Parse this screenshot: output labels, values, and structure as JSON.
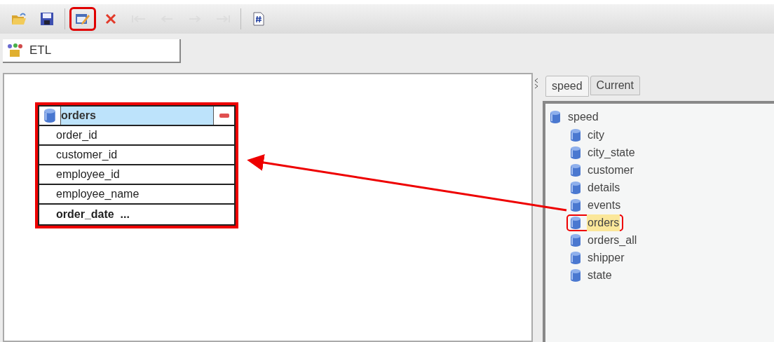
{
  "toolbar": [
    {
      "kind": "open",
      "disabled": false,
      "highlighted": false
    },
    {
      "kind": "save",
      "disabled": false,
      "highlighted": false
    },
    {
      "kind": "separator"
    },
    {
      "kind": "edit",
      "disabled": false,
      "highlighted": true
    },
    {
      "kind": "delete",
      "disabled": false,
      "highlighted": false
    },
    {
      "kind": "first",
      "disabled": true,
      "highlighted": false
    },
    {
      "kind": "prev",
      "disabled": true,
      "highlighted": false
    },
    {
      "kind": "next",
      "disabled": true,
      "highlighted": false
    },
    {
      "kind": "last",
      "disabled": true,
      "highlighted": false
    },
    {
      "kind": "separator"
    },
    {
      "kind": "script",
      "disabled": false,
      "highlighted": false
    }
  ],
  "module_tab": {
    "label": "ETL"
  },
  "table_card": {
    "title": "orders",
    "highlighted": true,
    "columns": [
      {
        "name": "order_id",
        "bold": false
      },
      {
        "name": "customer_id",
        "bold": false
      },
      {
        "name": "employee_id",
        "bold": false
      },
      {
        "name": "employee_name",
        "bold": false
      },
      {
        "name": "order_date  ...",
        "bold": true
      }
    ]
  },
  "side_tabs": [
    {
      "label": "speed",
      "selected": true
    },
    {
      "label": "Current",
      "selected": false
    }
  ],
  "tree": {
    "label": "speed",
    "children": [
      {
        "label": "city",
        "selected": false,
        "highlighted": false
      },
      {
        "label": "city_state",
        "selected": false,
        "highlighted": false
      },
      {
        "label": "customer",
        "selected": false,
        "highlighted": false
      },
      {
        "label": "details",
        "selected": false,
        "highlighted": false
      },
      {
        "label": "events",
        "selected": false,
        "highlighted": false
      },
      {
        "label": "orders",
        "selected": true,
        "highlighted": true
      },
      {
        "label": "orders_all",
        "selected": false,
        "highlighted": false
      },
      {
        "label": "shipper",
        "selected": false,
        "highlighted": false
      },
      {
        "label": "state",
        "selected": false,
        "highlighted": false
      }
    ]
  }
}
